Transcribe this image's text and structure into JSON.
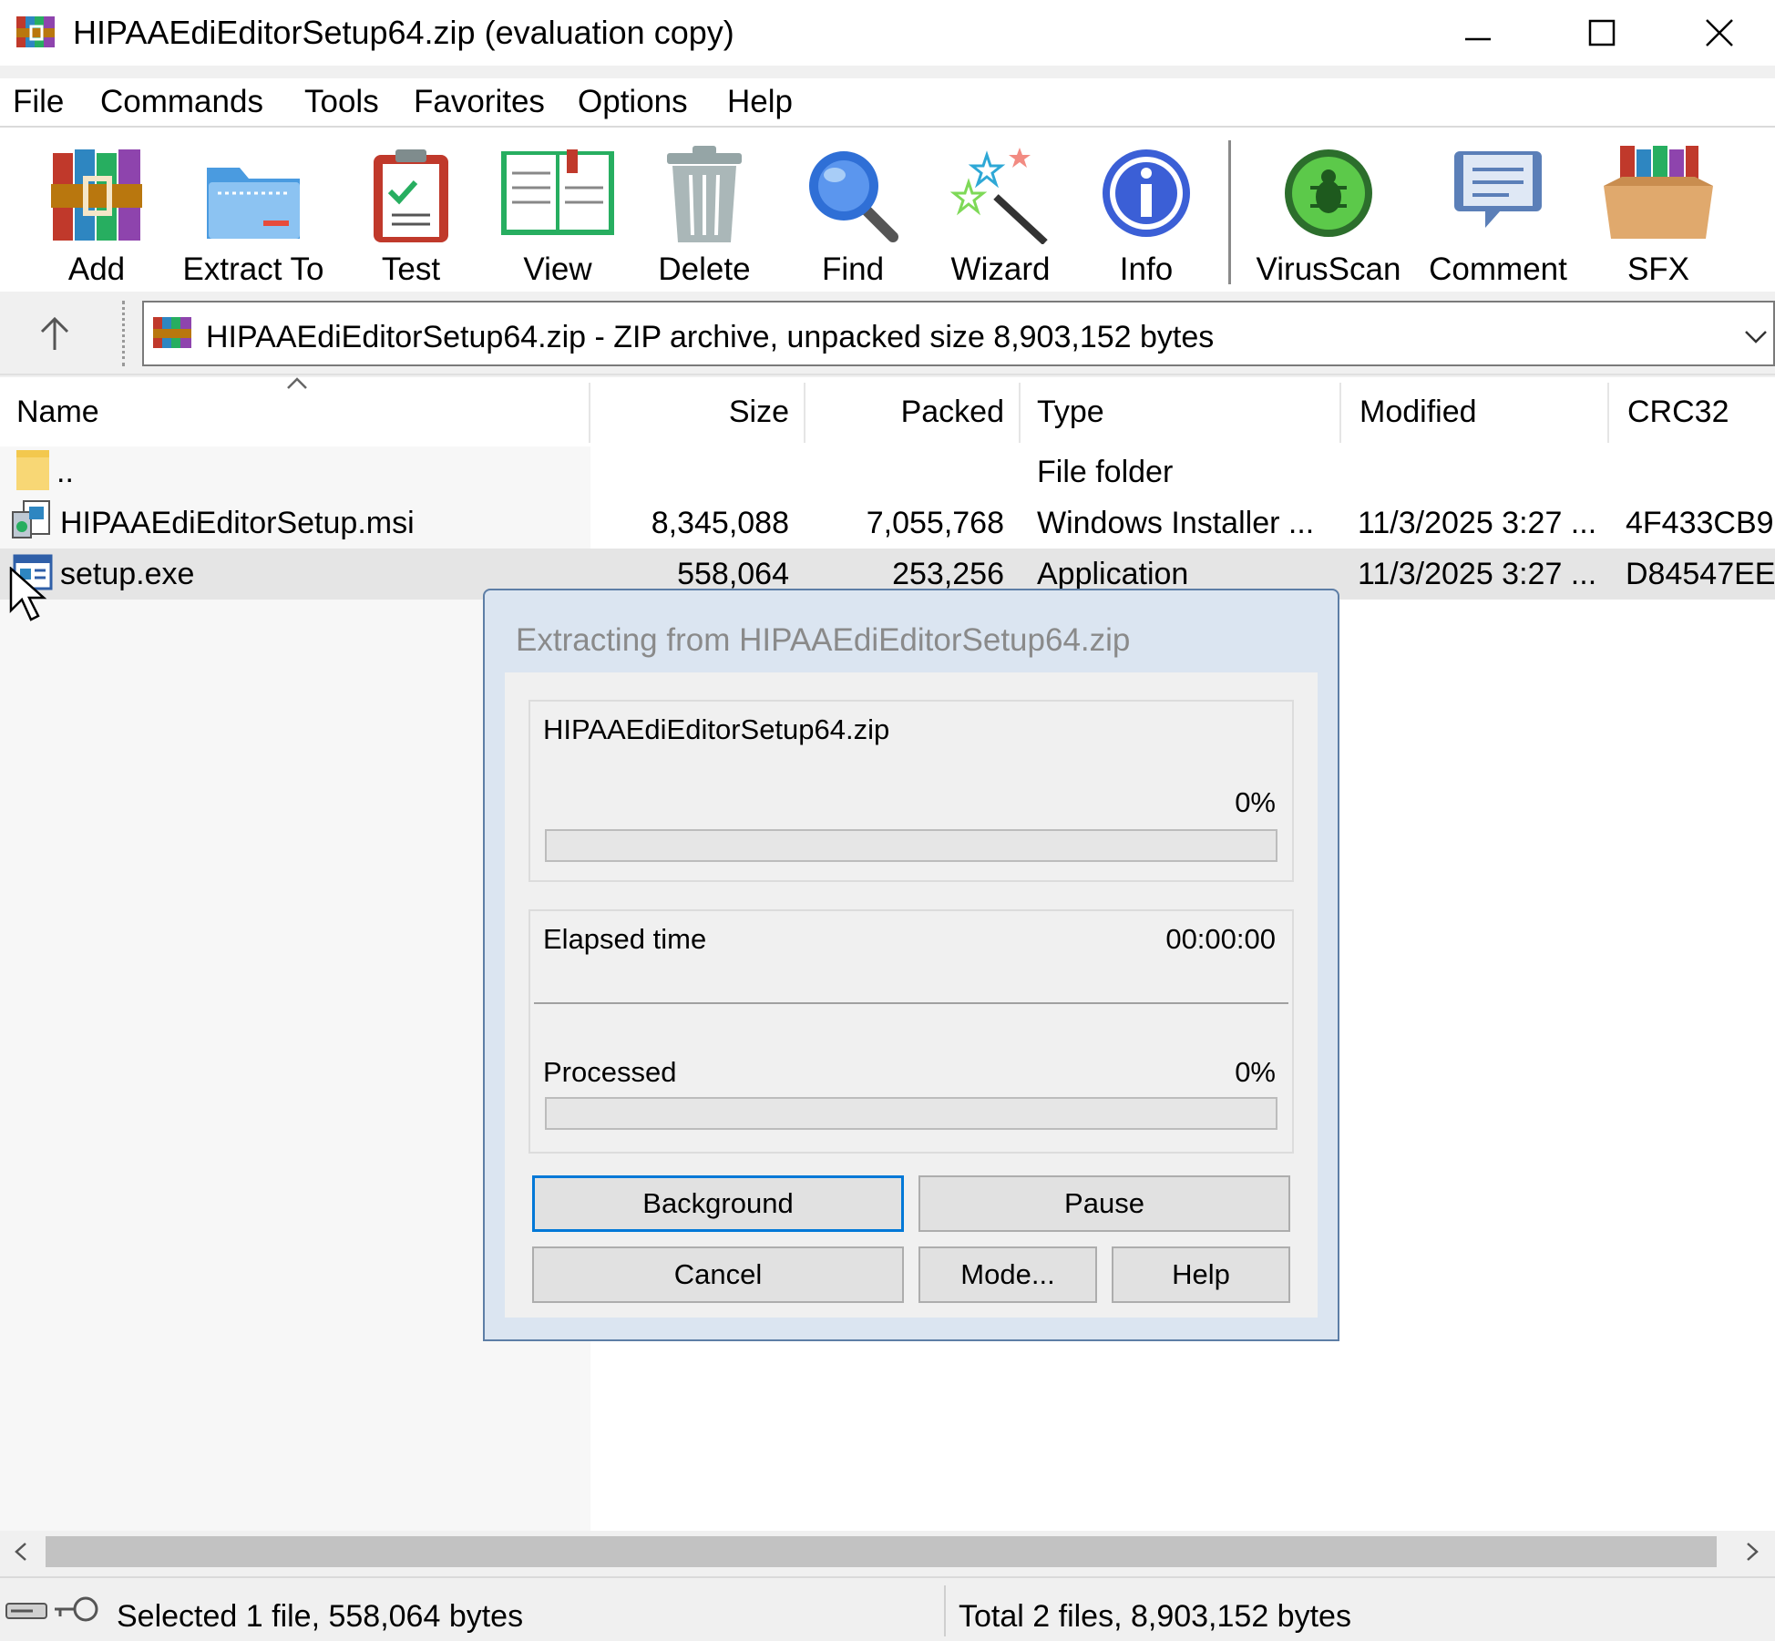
{
  "window": {
    "title": "HIPAAEdiEditorSetup64.zip (evaluation copy)"
  },
  "menu": [
    "File",
    "Commands",
    "Tools",
    "Favorites",
    "Options",
    "Help"
  ],
  "toolbar": {
    "buttons": [
      "Add",
      "Extract To",
      "Test",
      "View",
      "Delete",
      "Find",
      "Wizard",
      "Info",
      "VirusScan",
      "Comment",
      "SFX"
    ]
  },
  "address": {
    "text": "HIPAAEdiEditorSetup64.zip - ZIP archive, unpacked size 8,903,152 bytes"
  },
  "columns": [
    "Name",
    "Size",
    "Packed",
    "Type",
    "Modified",
    "CRC32"
  ],
  "files": [
    {
      "name": "..",
      "size": "",
      "packed": "",
      "type": "File folder",
      "modified": "",
      "crc": ""
    },
    {
      "name": "HIPAAEdiEditorSetup.msi",
      "size": "8,345,088",
      "packed": "7,055,768",
      "type": "Windows Installer ...",
      "modified": "11/3/2025 3:27 ...",
      "crc": "4F433CB9"
    },
    {
      "name": "setup.exe",
      "size": "558,064",
      "packed": "253,256",
      "type": "Application",
      "modified": "11/3/2025 3:27 ...",
      "crc": "D84547EE"
    }
  ],
  "status": {
    "left": "Selected 1 file, 558,064 bytes",
    "right": "Total 2 files, 8,903,152 bytes"
  },
  "dialog": {
    "title": "Extracting from HIPAAEdiEditorSetup64.zip",
    "archive": "HIPAAEdiEditorSetup64.zip",
    "file_percent_label": "0%",
    "file_progress": 0,
    "elapsed_label": "Elapsed time",
    "elapsed_value": "00:00:00",
    "processed_label": "Processed",
    "processed_percent_label": "0%",
    "processed_progress": 0,
    "buttons": {
      "background": "Background",
      "pause": "Pause",
      "cancel": "Cancel",
      "mode": "Mode...",
      "help": "Help"
    }
  },
  "colors": {
    "progress_fill": "#06b025",
    "selection": "#e5e5e5",
    "default_button_border": "#0078d7"
  }
}
